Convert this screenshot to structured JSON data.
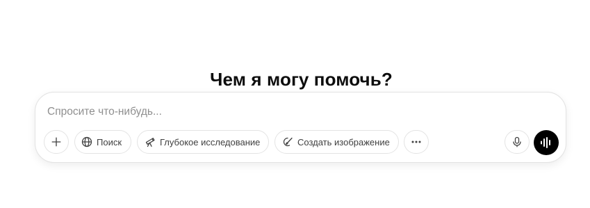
{
  "main": {
    "heading": "Чем я могу помочь?"
  },
  "composer": {
    "placeholder": "Спросите что-нибудь...",
    "value": ""
  },
  "toolbar": {
    "attach_icon": "plus-icon",
    "search": {
      "label": "Поиск",
      "icon": "globe-icon"
    },
    "deep_research": {
      "label": "Глубокое исследование",
      "icon": "telescope-icon"
    },
    "create_image": {
      "label": "Создать изображение",
      "icon": "paintbrush-icon"
    },
    "more_icon": "ellipsis-icon",
    "mic_icon": "microphone-icon",
    "voice_icon": "voice-waveform-icon"
  },
  "colors": {
    "text": "#0d0d0d",
    "placeholder": "#8f8f8f",
    "border": "#e3e3e3",
    "voice_button_bg": "#000000"
  }
}
